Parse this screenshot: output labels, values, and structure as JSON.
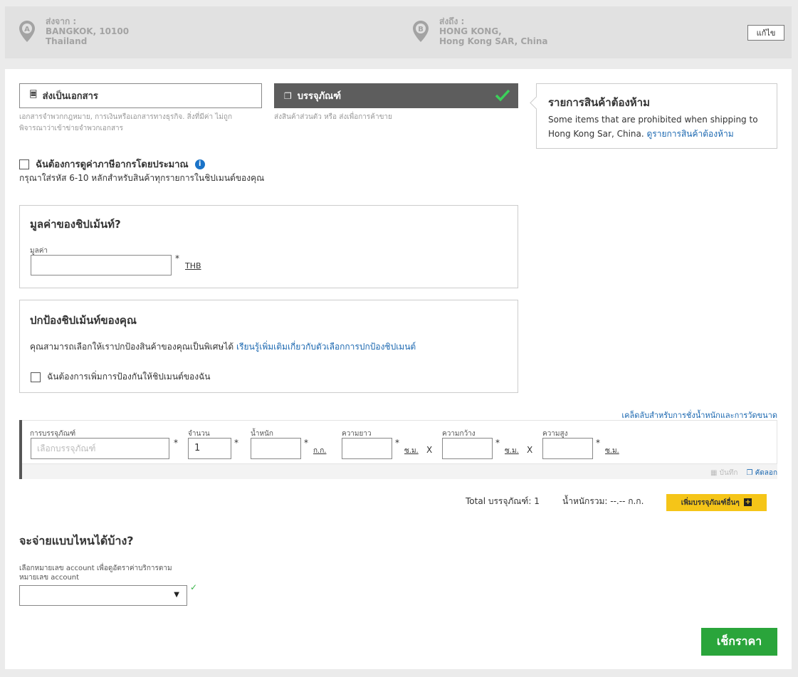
{
  "from": {
    "label": "ส่งจาก :",
    "line1": "BANGKOK, 10100",
    "line2": "Thailand",
    "pin_letter": "A"
  },
  "to": {
    "label": "ส่งถึง :",
    "line1": "HONG KONG,",
    "line2": "Hong Kong SAR, China",
    "pin_letter": "B"
  },
  "edit_label": "แก้ไข",
  "shipment_type": {
    "document_label": "ส่งเป็นเอกสาร",
    "document_desc": "เอกสารจำพวกกฎหมาย, การเงินหรือเอกสารทางธุรกิจ. สิ่งที่มีค่า ไม่ถูกพิจารณาว่าเข้าข่ายจำพวกเอกสาร",
    "package_label": "บรรจุภัณฑ์",
    "package_desc": "ส่งสินค้าส่วนตัว หรือ ส่งเพื่อการค้าขาย",
    "selected": "package"
  },
  "prohibited": {
    "title": "รายการสินค้าต้องห้าม",
    "text": "Some items that are prohibited when shipping to Hong Kong Sar, China.",
    "link": "ดูรายการสินค้าต้องห้าม"
  },
  "duty": {
    "label": "ฉันต้องการดูค่าภาษีอากรโดยประมาณ",
    "info_icon": "i",
    "sub": "กรุณาใส่รหัส 6-10 หลักสำหรับสินค้าทุกรายการในชิปเมนต์ของคุณ"
  },
  "value_section": {
    "title": "มูลค่าของชิปเม้นท์?",
    "field_label": "มูลค่า",
    "required": "*",
    "currency": "THB"
  },
  "protect_section": {
    "title": "ปกป้องชิปเม้นท์ของคุณ",
    "text": "คุณสามารถเลือกให้เราปกป้องสินค้าของคุณเป็นพิเศษได้",
    "link": "เรียนรู้เพิ่มเติมเกี่ยวกับตัวเลือกการปกป้องชิปเมนต์",
    "checkbox_label": "ฉันต้องการเพิ่มการป้องกันให้ชิปเมนต์ของฉัน"
  },
  "tips_link": "เคล็ดลับสำหรับการชั่งน้ำหนักและการวัดขนาด",
  "package_row": {
    "packaging_label": "การบรรจุภัณฑ์",
    "packaging_placeholder": "เลือกบรรจุภัณฑ์",
    "quantity_label": "จำนวน",
    "quantity_value": "1",
    "weight_label": "น้ำหนัก",
    "weight_unit": "ก.ก.",
    "length_label": "ความยาว",
    "width_label": "ความกว้าง",
    "height_label": "ความสูง",
    "dim_unit": "ซ.ม.",
    "times": "X",
    "required": "*",
    "save_label": "บันทึก",
    "copy_label": "คัดลอก"
  },
  "totals": {
    "count_text": "Total บรรจุภัณฑ์: 1",
    "weight_text": "น้ำหนักรวม: --.-- ก.ก.",
    "add_label": "เพิ่มบรรจุภัณฑ์อื่นๆ",
    "add_plus": "+"
  },
  "payment": {
    "title": "จะจ่ายแบบไหนได้บ้าง?",
    "field_label": "เลือกหมายเลข account เพื่อดูอัตราค่าบริการตามหมายเลข account",
    "check": "✓",
    "caret": "▼"
  },
  "quote_button": "เช็กราคา",
  "colors": {
    "accent_yellow": "#f5c518",
    "accent_green": "#2aa53b",
    "link_blue": "#1a67b0",
    "selected_dark": "#5d5d5d"
  }
}
